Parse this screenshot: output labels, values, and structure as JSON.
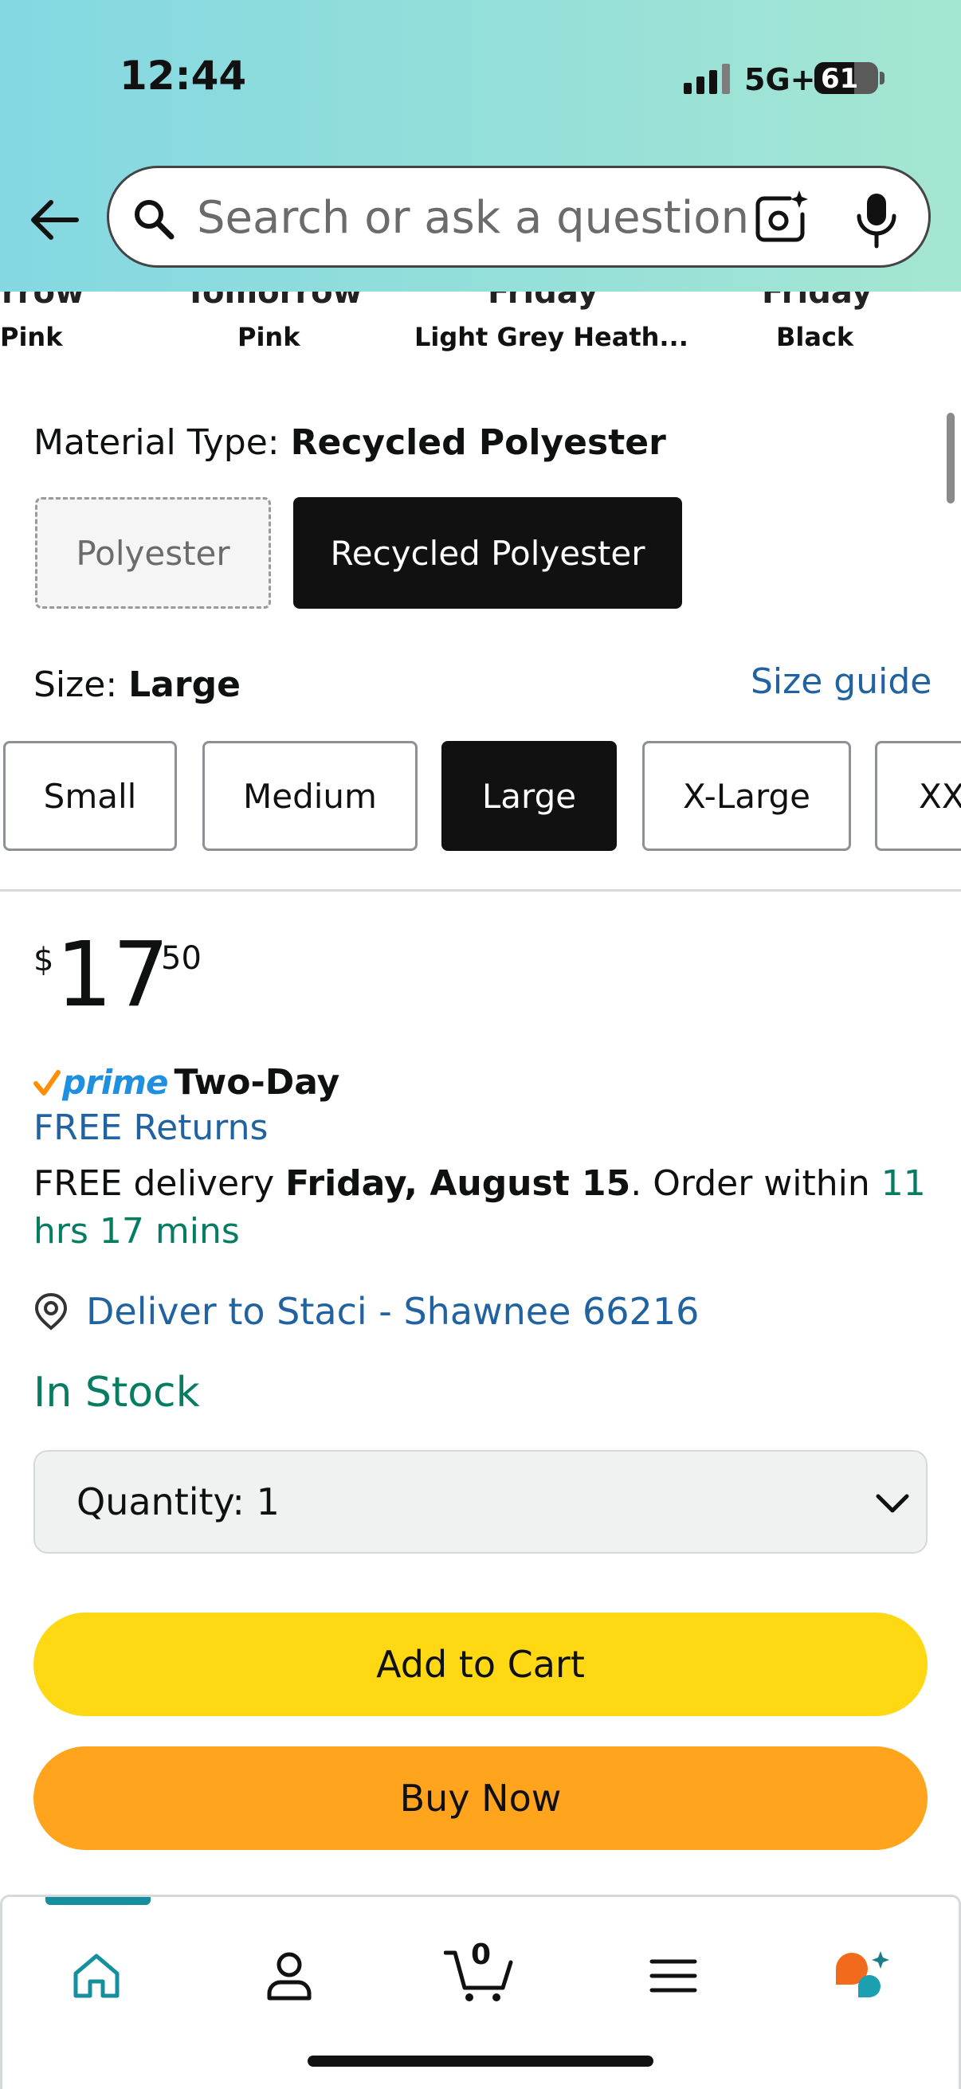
{
  "status_bar": {
    "time": "12:44",
    "network": "5G+",
    "battery": "61"
  },
  "header": {
    "search_placeholder": "Search or ask a question"
  },
  "colors_row": {
    "items": [
      {
        "top": "rrow",
        "name": "Pink"
      },
      {
        "top": "Tomorrow",
        "name": "Pink"
      },
      {
        "top": "Friday",
        "name": "Light Grey Heath..."
      },
      {
        "top": "Friday",
        "name": "Black"
      }
    ]
  },
  "material": {
    "label": "Material Type: ",
    "value": "Recycled Polyester",
    "options": [
      "Polyester",
      "Recycled Polyester"
    ]
  },
  "size": {
    "label": "Size: ",
    "value": "Large",
    "guide": "Size guide",
    "options": [
      "Small",
      "Medium",
      "Large",
      "X-Large",
      "XX"
    ]
  },
  "price": {
    "symbol": "$",
    "whole": "17",
    "fraction": "50"
  },
  "delivery": {
    "prime": "prime",
    "prime_speed": "Two-Day",
    "free_returns": "FREE Returns",
    "prefix": "FREE delivery ",
    "date": "Friday, August 15",
    "order_within": ". Order within ",
    "countdown": "11 hrs 17 mins",
    "deliver_to": "Deliver to Staci - Shawnee 66216"
  },
  "stock": "In Stock",
  "quantity": {
    "label": "Quantity:",
    "value": "1"
  },
  "buttons": {
    "add_to_cart": "Add to Cart",
    "buy_now": "Buy Now"
  },
  "nav": {
    "cart_count": "0"
  },
  "theme": {
    "accent_blue": "#2162a1",
    "green": "#067d62",
    "cart_yellow": "#ffd814",
    "buy_orange": "#ffa41c",
    "teal": "#158f9e"
  }
}
